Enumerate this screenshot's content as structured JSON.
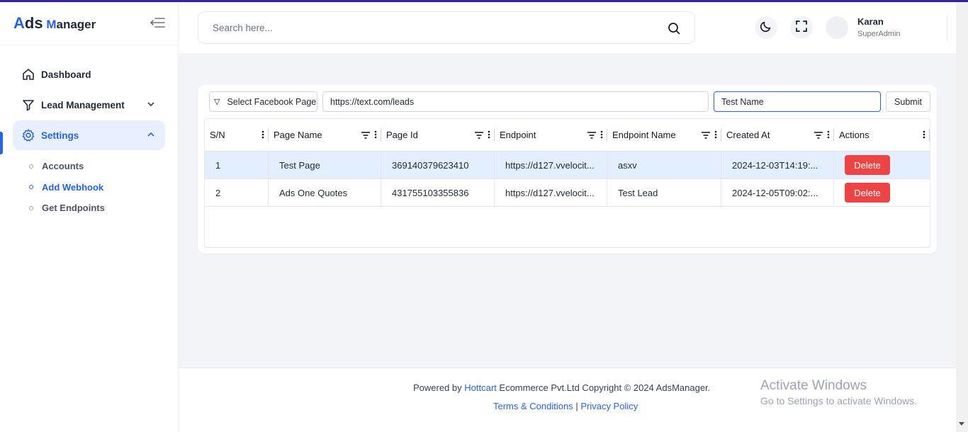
{
  "brand": {
    "first": "A",
    "rest": "ds",
    "m": "M",
    "anager": "anager"
  },
  "sidebar": {
    "items": [
      {
        "label": "Dashboard"
      },
      {
        "label": "Lead Management"
      },
      {
        "label": "Settings"
      }
    ],
    "sub_items": [
      {
        "label": "Accounts"
      },
      {
        "label": "Add Webhook"
      },
      {
        "label": "Get Endpoints"
      }
    ]
  },
  "header": {
    "search_placeholder": "Search here...",
    "user_name": "Karan",
    "user_role": "SuperAdmin"
  },
  "form": {
    "select_label": "Select Facebook Page",
    "select_icon": "▽",
    "endpoint_value": "https://text.com/leads",
    "name_value": "Test Name",
    "submit_label": "Submit"
  },
  "table": {
    "columns": [
      "S/N",
      "Page Name",
      "Page Id",
      "Endpoint",
      "Endpoint Name",
      "Created At",
      "Actions"
    ],
    "rows": [
      {
        "sn": "1",
        "page_name": "Test Page",
        "page_id": "369140379623410",
        "endpoint": "https://d127.vvelocit...",
        "endpoint_name": "asxv",
        "created_at": "2024-12-03T14:19:...",
        "action": "Delete"
      },
      {
        "sn": "2",
        "page_name": "Ads One Quotes",
        "page_id": "431755103355836",
        "endpoint": "https://d127.vvelocit...",
        "endpoint_name": "Test Lead",
        "created_at": "2024-12-05T09:02:...",
        "action": "Delete"
      }
    ]
  },
  "footer": {
    "powered_prefix": "Powered by ",
    "company_link": "Hottcart",
    "powered_suffix": " Ecommerce Pvt.Ltd Copyright © 2024 AdsManager.",
    "terms": "Terms & Conditions",
    "separator": " | ",
    "privacy": "Privacy Policy"
  },
  "watermark": {
    "line1": "Activate Windows",
    "line2": "Go to Settings to activate Windows."
  },
  "colors": {
    "accent": "#2563eb",
    "danger": "#ef4444",
    "selected_row": "#e3efff"
  }
}
